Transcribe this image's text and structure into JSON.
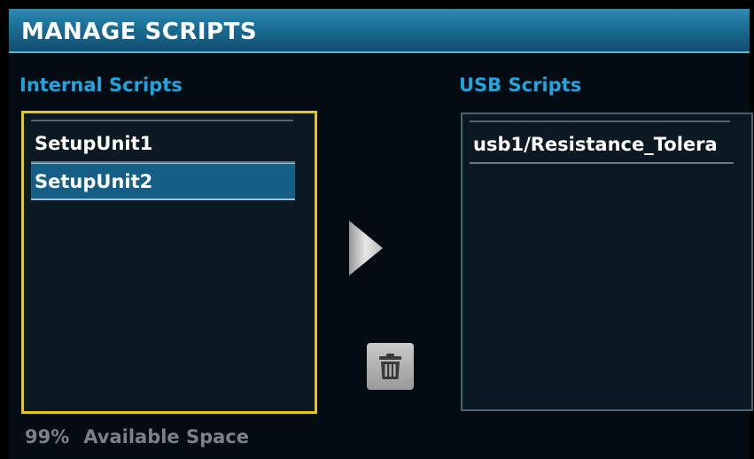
{
  "header": {
    "title": "MANAGE SCRIPTS"
  },
  "internal": {
    "label": "Internal Scripts",
    "items": [
      {
        "label": "SetupUnit1",
        "selected": false
      },
      {
        "label": "SetupUnit2",
        "selected": true
      }
    ]
  },
  "usb": {
    "label": "USB Scripts",
    "items": [
      {
        "label": "usb1/Resistance_Tolera",
        "selected": false
      }
    ]
  },
  "actions": {
    "copy_icon": "right-arrow-icon",
    "delete_icon": "trash-icon"
  },
  "footer": {
    "percent": "99%",
    "label": "Available Space"
  },
  "colors": {
    "accent": "#22a4de",
    "focus_border": "#e6c619",
    "selection": "#155f86",
    "title_bar": "#1b6d94"
  }
}
